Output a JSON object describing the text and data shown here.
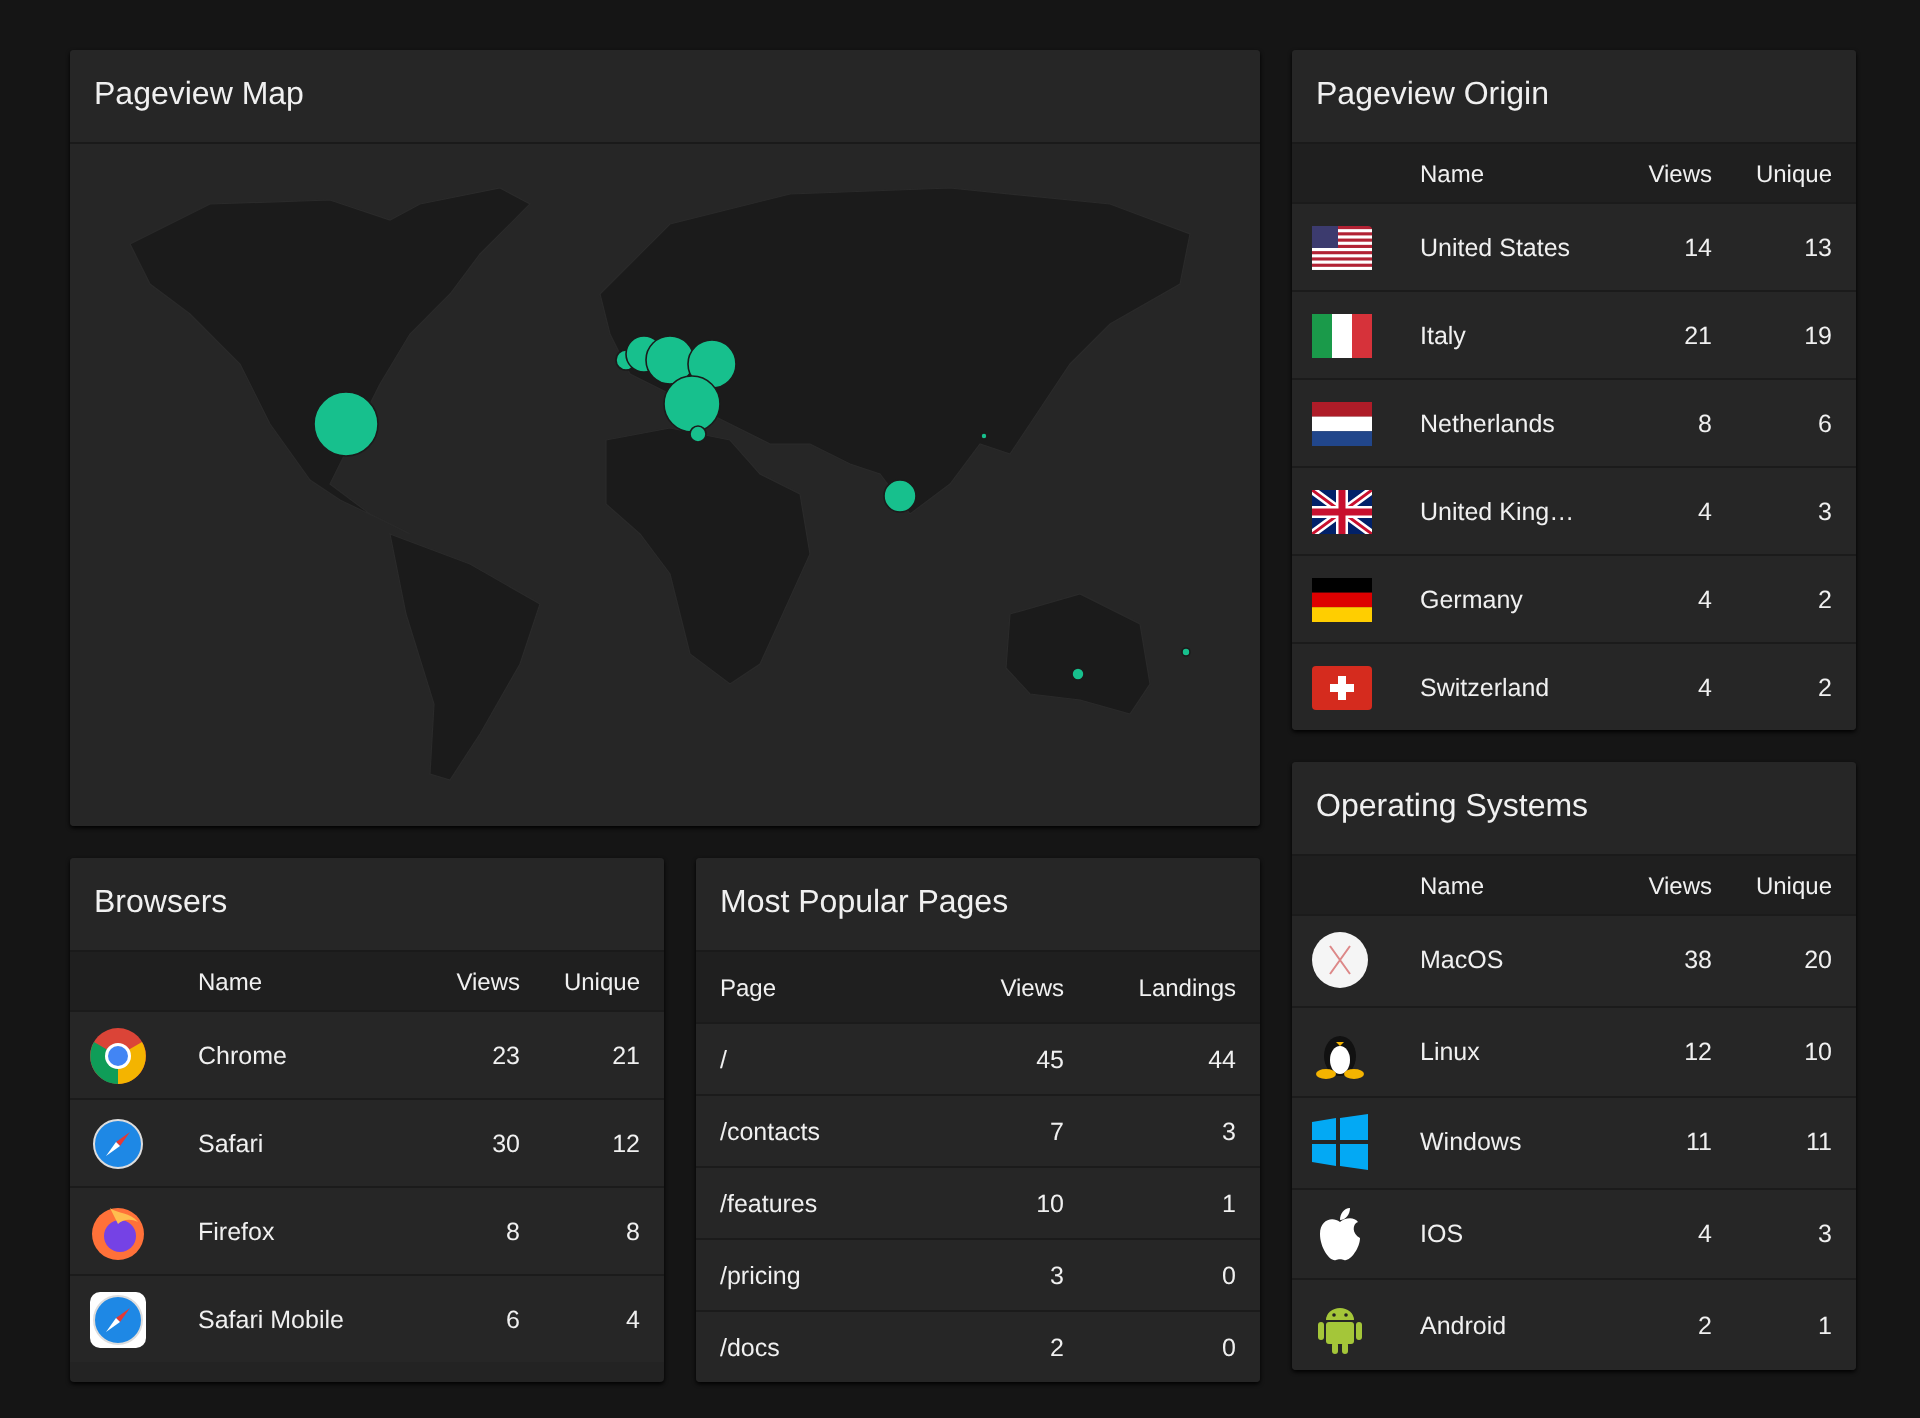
{
  "map": {
    "title": "Pageview Map"
  },
  "origin": {
    "title": "Pageview Origin",
    "columns": [
      "Name",
      "Views",
      "Unique"
    ],
    "rows": [
      {
        "kind": "us",
        "name": "United States",
        "views": "14",
        "unique": "13"
      },
      {
        "kind": "it",
        "name": "Italy",
        "views": "21",
        "unique": "19"
      },
      {
        "kind": "nl",
        "name": "Netherlands",
        "views": "8",
        "unique": "6"
      },
      {
        "kind": "gb",
        "name": "United King…",
        "views": "4",
        "unique": "3"
      },
      {
        "kind": "de",
        "name": "Germany",
        "views": "4",
        "unique": "2"
      },
      {
        "kind": "ch",
        "name": "Switzerland",
        "views": "4",
        "unique": "2"
      }
    ]
  },
  "browsers": {
    "title": "Browsers",
    "columns": [
      "Name",
      "Views",
      "Unique"
    ],
    "rows": [
      {
        "kind": "chrome",
        "name": "Chrome",
        "views": "23",
        "unique": "21"
      },
      {
        "kind": "safari",
        "name": "Safari",
        "views": "30",
        "unique": "12"
      },
      {
        "kind": "firefox",
        "name": "Firefox",
        "views": "8",
        "unique": "8"
      },
      {
        "kind": "safari-mobile",
        "name": "Safari Mobile",
        "views": "6",
        "unique": "4"
      }
    ]
  },
  "pages": {
    "title": "Most Popular Pages",
    "columns": [
      "Page",
      "Views",
      "Landings"
    ],
    "rows": [
      {
        "page": "/",
        "views": "45",
        "landings": "44"
      },
      {
        "page": "/contacts",
        "views": "7",
        "landings": "3"
      },
      {
        "page": "/features",
        "views": "10",
        "landings": "1"
      },
      {
        "page": "/pricing",
        "views": "3",
        "landings": "0"
      },
      {
        "page": "/docs",
        "views": "2",
        "landings": "0"
      }
    ]
  },
  "os": {
    "title": "Operating Systems",
    "columns": [
      "Name",
      "Views",
      "Unique"
    ],
    "rows": [
      {
        "kind": "macos",
        "name": "MacOS",
        "views": "38",
        "unique": "20"
      },
      {
        "kind": "linux",
        "name": "Linux",
        "views": "12",
        "unique": "10"
      },
      {
        "kind": "windows",
        "name": "Windows",
        "views": "11",
        "unique": "11"
      },
      {
        "kind": "ios",
        "name": "IOS",
        "views": "4",
        "unique": "3"
      },
      {
        "kind": "android",
        "name": "Android",
        "views": "2",
        "unique": "1"
      }
    ]
  }
}
